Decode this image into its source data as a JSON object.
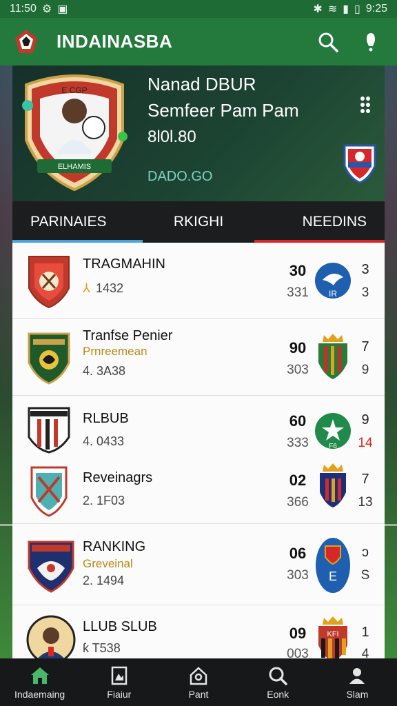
{
  "status": {
    "time": "11:50",
    "right_time": "9:25"
  },
  "appbar": {
    "title": "INDAINASBA"
  },
  "hero": {
    "name": "Nanad DBUR",
    "subtitle": "Semfeer Pam Pam",
    "number": "8l0l.80",
    "price": "DADO.GO",
    "badge_text": "ELHAMIS",
    "badge_top": "E   CGP"
  },
  "tabs": [
    {
      "label": "PARINAIES",
      "underline": "#4aa3d8"
    },
    {
      "label": "RKIGHI",
      "underline": ""
    },
    {
      "label": "NEEDINS",
      "underline": "#d62828"
    }
  ],
  "rows": [
    {
      "team": "TRAGMAHIN",
      "subtitle": "",
      "meta": "1432",
      "mark": "⅄",
      "score": "30",
      "score2": "331",
      "rank": "3",
      "rank2": "3",
      "rank2_red": false,
      "crest": "red",
      "opp": "blue-circle",
      "opp_text": "IR"
    },
    {
      "team": "Tranfse Penier",
      "subtitle": "Prnreemean",
      "meta": "4. 3A38",
      "mark": "",
      "score": "90",
      "score2": "303",
      "rank": "7",
      "rank2": "9",
      "rank2_red": false,
      "crest": "green",
      "opp": "shield-stripes"
    },
    {
      "team": "RLBUB",
      "subtitle": "",
      "meta": "4. 0433",
      "mark": "",
      "score": "60",
      "score2": "333",
      "rank": "9",
      "rank2": "14",
      "rank2_red": true,
      "crest": "bw",
      "opp": "green-circle",
      "opp_text": "F6"
    },
    {
      "team": "Reveinagrs",
      "subtitle": "",
      "meta": "2. 1F03",
      "mark": "",
      "score": "02",
      "score2": "366",
      "rank": "7",
      "rank2": "13",
      "rank2_red": false,
      "crest": "teal",
      "opp": "navy-shield"
    },
    {
      "team": "RANKING",
      "subtitle": "Greveinal",
      "meta": "2. 1494",
      "mark": "",
      "score": "06",
      "score2": "303",
      "rank": "ɔ",
      "rank2": "S",
      "rank2_red": false,
      "crest": "navy",
      "opp": "blue-oval",
      "opp_text": "E"
    },
    {
      "team": "LLUB SLUB",
      "subtitle": "",
      "meta": "ƙ T538",
      "mark": "",
      "score": "09",
      "score2": "003",
      "rank": "1",
      "rank2": "4",
      "rank2_red": false,
      "crest": "player",
      "opp": "stripes-crown",
      "opp_text": "KFI"
    }
  ],
  "nav": [
    {
      "label": "Indaemaing",
      "icon": "home-icon"
    },
    {
      "label": "Fiaiur",
      "icon": "document-icon"
    },
    {
      "label": "Pant",
      "icon": "house-outline-icon"
    },
    {
      "label": "Eonk",
      "icon": "search-icon"
    },
    {
      "label": "Slam",
      "icon": "profile-icon"
    }
  ],
  "colors": {
    "primary": "#237a3c",
    "statusbar": "#1e6b35",
    "tabbar": "#1b1d1f",
    "accent_red": "#d62828",
    "accent_blue": "#4aa3d8",
    "navbar": "#161819"
  }
}
